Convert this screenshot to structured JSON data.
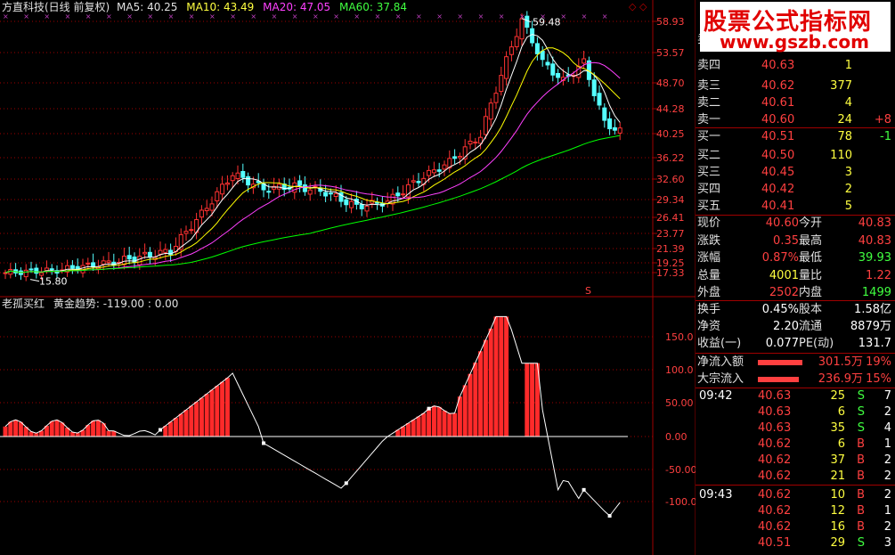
{
  "header": {
    "stock_title": "方直科技(日线 前复权)",
    "ma5": "MA5: 40.25",
    "ma10": "MA10: 43.49",
    "ma20": "MA20: 47.05",
    "ma60": "MA60: 37.84",
    "indicator_title": "老孤买红",
    "indicator_values": "黄金趋势: -119.00 : 0.00"
  },
  "price_axis": [
    "58.93",
    "53.57",
    "48.70",
    "44.28",
    "40.25",
    "36.22",
    "32.60",
    "29.34",
    "26.41",
    "23.77",
    "21.39",
    "19.25",
    "17.33"
  ],
  "indicator_axis": [
    "150.0",
    "100.0",
    "50.00",
    "0.00",
    "-50.00",
    "-100.0"
  ],
  "annotations": {
    "high": "59.48",
    "low": "15.80",
    "s_marker": "S"
  },
  "colors": {
    "up": "#ff3232",
    "down": "#54ffff",
    "ma5": "#ffffff",
    "ma10": "#ffff00",
    "ma20": "#ff40ff",
    "ma60": "#00ff00",
    "grid": "#a00000"
  },
  "logo": {
    "title": "股票公式指标网",
    "url": "www.gszb.com"
  },
  "order_book": [
    {
      "label": "卖五",
      "price": "",
      "vol": "",
      "chg": ""
    },
    {
      "label": "卖四",
      "price": "40.63",
      "vol": "1",
      "chg": ""
    },
    {
      "label": "卖三",
      "price": "40.62",
      "vol": "377",
      "chg": ""
    },
    {
      "label": "卖二",
      "price": "40.61",
      "vol": "4",
      "chg": ""
    },
    {
      "label": "卖一",
      "price": "40.60",
      "vol": "24",
      "chg": "+8"
    },
    {
      "label": "买一",
      "price": "40.51",
      "vol": "78",
      "chg": "-1"
    },
    {
      "label": "买二",
      "price": "40.50",
      "vol": "110",
      "chg": ""
    },
    {
      "label": "买三",
      "price": "40.45",
      "vol": "3",
      "chg": ""
    },
    {
      "label": "买四",
      "price": "40.42",
      "vol": "2",
      "chg": ""
    },
    {
      "label": "买五",
      "price": "40.41",
      "vol": "5",
      "chg": ""
    }
  ],
  "quote": [
    {
      "l1": "现价",
      "v1": "40.60",
      "l2": "今开",
      "v2": "40.83"
    },
    {
      "l1": "涨跌",
      "v1": "0.35",
      "l2": "最高",
      "v2": "40.83"
    },
    {
      "l1": "涨幅",
      "v1": "0.87%",
      "l2": "最低",
      "v2": "39.93"
    },
    {
      "l1": "总量",
      "v1": "4001",
      "l2": "量比",
      "v2": "1.22"
    },
    {
      "l1": "外盘",
      "v1": "2502",
      "l2": "内盘",
      "v2": "1499"
    }
  ],
  "stats": [
    {
      "l1": "换手",
      "v1": "0.45%",
      "l2": "股本",
      "v2": "1.58亿"
    },
    {
      "l1": "净资",
      "v1": "2.20",
      "l2": "流通",
      "v2": "8879万"
    },
    {
      "l1": "收益(一)",
      "v1": "0.077",
      "l2": "PE(动)",
      "v2": "131.7"
    }
  ],
  "flows": [
    {
      "label": "净流入额",
      "value": "301.5万",
      "pct": "19%"
    },
    {
      "label": "大宗流入",
      "value": "236.9万",
      "pct": "15%"
    }
  ],
  "trades": [
    {
      "time": "09:42",
      "price": "40.63",
      "vol": "25",
      "side": "S",
      "n": "7"
    },
    {
      "time": "",
      "price": "40.63",
      "vol": "6",
      "side": "S",
      "n": "2"
    },
    {
      "time": "",
      "price": "40.63",
      "vol": "35",
      "side": "S",
      "n": "4"
    },
    {
      "time": "",
      "price": "40.62",
      "vol": "6",
      "side": "B",
      "n": "1"
    },
    {
      "time": "",
      "price": "40.62",
      "vol": "37",
      "side": "B",
      "n": "2"
    },
    {
      "time": "",
      "price": "40.62",
      "vol": "21",
      "side": "B",
      "n": "2"
    },
    {
      "time": "09:43",
      "price": "40.62",
      "vol": "10",
      "side": "B",
      "n": "2"
    },
    {
      "time": "",
      "price": "40.62",
      "vol": "12",
      "side": "B",
      "n": "1"
    },
    {
      "time": "",
      "price": "40.62",
      "vol": "16",
      "side": "B",
      "n": "2"
    },
    {
      "time": "",
      "price": "40.51",
      "vol": "29",
      "side": "S",
      "n": "3"
    }
  ],
  "chart_data": {
    "type": "candlestick",
    "price_range": [
      15.8,
      59.48
    ],
    "indicator_range": [
      -119,
      180
    ],
    "series": [
      {
        "name": "MA5",
        "last": 40.25
      },
      {
        "name": "MA10",
        "last": 43.49
      },
      {
        "name": "MA20",
        "last": 47.05
      },
      {
        "name": "MA60",
        "last": 37.84
      }
    ],
    "indicator_last": [
      -119.0,
      0.0
    ]
  }
}
